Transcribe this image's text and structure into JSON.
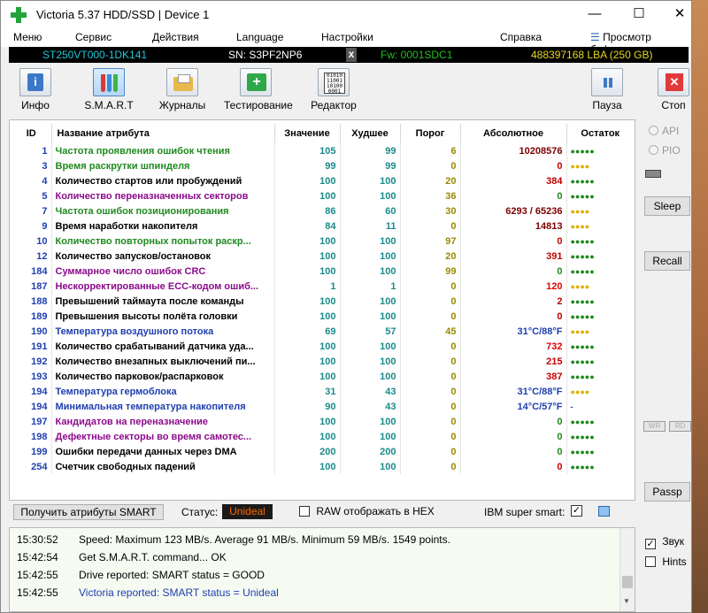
{
  "window": {
    "title": "Victoria 5.37 HDD/SSD | Device 1",
    "controls": {
      "minimize": "—",
      "maximize": "☐",
      "close": "✕"
    }
  },
  "menu": {
    "items": [
      "Меню",
      "Сервис",
      "Действия",
      "Language",
      "Настройки",
      "Справка"
    ],
    "buffer_view": "Просмотр буфера"
  },
  "drive": {
    "model": "ST250VT000-1DK141",
    "serial": "SN: S3PF2NP6",
    "close": "x",
    "firmware": "Fw: 0001SDC1",
    "lba": "488397168 LBA (250 GB)"
  },
  "toolbar": {
    "info": "Инфо",
    "smart": "S.M.A.R.T",
    "logs": "Журналы",
    "testing": "Тестирование",
    "editor": "Редактор",
    "pause": "Пауза",
    "stop": "Стоп"
  },
  "table": {
    "headers": [
      "ID",
      "Название атрибута",
      "Значение",
      "Худшее",
      "Порог",
      "Абсолютное",
      "Остаток"
    ],
    "rows": [
      {
        "id": "1",
        "name": "Частота проявления ошибок чтения",
        "value": "105",
        "worst": "99",
        "threshold": "6",
        "raw": "10208576",
        "rest": "●●●●●",
        "name_color": "#1f8a1f",
        "raw_color": "#7a0000",
        "rest_color": "#1f8a1f"
      },
      {
        "id": "3",
        "name": "Время раскрутки шпинделя",
        "value": "99",
        "worst": "99",
        "threshold": "0",
        "raw": "0",
        "rest": "●●●●",
        "name_color": "#1f8a1f",
        "raw_color": "#c00000",
        "rest_color": "#e0b000"
      },
      {
        "id": "4",
        "name": "Количество стартов или пробуждений",
        "value": "100",
        "worst": "100",
        "threshold": "20",
        "raw": "384",
        "rest": "●●●●●",
        "name_color": "#000000",
        "raw_color": "#c00000",
        "rest_color": "#1f8a1f"
      },
      {
        "id": "5",
        "name": "Количество переназначенных секторов",
        "value": "100",
        "worst": "100",
        "threshold": "36",
        "raw": "0",
        "rest": "●●●●●",
        "name_color": "#8b0a8b",
        "raw_color": "#1f8a1f",
        "rest_color": "#1f8a1f"
      },
      {
        "id": "7",
        "name": "Частота ошибок позиционирования",
        "value": "86",
        "worst": "60",
        "threshold": "30",
        "raw": "6293 / 65236",
        "rest": "●●●●",
        "name_color": "#1f8a1f",
        "raw_color": "#7a0000",
        "rest_color": "#e0b000"
      },
      {
        "id": "9",
        "name": "Время наработки накопителя",
        "value": "84",
        "worst": "11",
        "threshold": "0",
        "raw": "14813",
        "rest": "●●●●",
        "name_color": "#000000",
        "raw_color": "#7a0000",
        "rest_color": "#e0b000"
      },
      {
        "id": "10",
        "name": "Количество повторных попыток раскр...",
        "value": "100",
        "worst": "100",
        "threshold": "97",
        "raw": "0",
        "rest": "●●●●●",
        "name_color": "#1f8a1f",
        "raw_color": "#c00000",
        "rest_color": "#1f8a1f"
      },
      {
        "id": "12",
        "name": "Количество запусков/остановок",
        "value": "100",
        "worst": "100",
        "threshold": "20",
        "raw": "391",
        "rest": "●●●●●",
        "name_color": "#000000",
        "raw_color": "#c00000",
        "rest_color": "#1f8a1f"
      },
      {
        "id": "184",
        "name": "Суммарное число ошибок CRC",
        "value": "100",
        "worst": "100",
        "threshold": "99",
        "raw": "0",
        "rest": "●●●●●",
        "name_color": "#8b0a8b",
        "raw_color": "#1f8a1f",
        "rest_color": "#1f8a1f"
      },
      {
        "id": "187",
        "name": "Нескорректированные ECC-кодом ошиб...",
        "value": "1",
        "worst": "1",
        "threshold": "0",
        "raw": "120",
        "rest": "●●●●",
        "name_color": "#8b0a8b",
        "raw_color": "#e00000",
        "rest_color": "#e0b000"
      },
      {
        "id": "188",
        "name": "Превышений таймаута после команды",
        "value": "100",
        "worst": "100",
        "threshold": "0",
        "raw": "2",
        "rest": "●●●●●",
        "name_color": "#000000",
        "raw_color": "#c00000",
        "rest_color": "#1f8a1f"
      },
      {
        "id": "189",
        "name": "Превышения высоты полёта головки",
        "value": "100",
        "worst": "100",
        "threshold": "0",
        "raw": "0",
        "rest": "●●●●●",
        "name_color": "#000000",
        "raw_color": "#c00000",
        "rest_color": "#1f8a1f"
      },
      {
        "id": "190",
        "name": "Температура воздушного потока",
        "value": "69",
        "worst": "57",
        "threshold": "45",
        "raw": "31°C/88°F",
        "rest": "●●●●",
        "name_color": "#1f3fb0",
        "raw_color": "#1f3fb0",
        "rest_color": "#e0b000"
      },
      {
        "id": "191",
        "name": "Количество срабатываний датчика уда...",
        "value": "100",
        "worst": "100",
        "threshold": "0",
        "raw": "732",
        "rest": "●●●●●",
        "name_color": "#000000",
        "raw_color": "#e00000",
        "rest_color": "#1f8a1f"
      },
      {
        "id": "192",
        "name": "Количество внезапных выключений пи...",
        "value": "100",
        "worst": "100",
        "threshold": "0",
        "raw": "215",
        "rest": "●●●●●",
        "name_color": "#000000",
        "raw_color": "#c00000",
        "rest_color": "#1f8a1f"
      },
      {
        "id": "193",
        "name": "Количество парковок/распарковок",
        "value": "100",
        "worst": "100",
        "threshold": "0",
        "raw": "387",
        "rest": "●●●●●",
        "name_color": "#000000",
        "raw_color": "#c00000",
        "rest_color": "#1f8a1f"
      },
      {
        "id": "194",
        "name": "Температура гермоблока",
        "value": "31",
        "worst": "43",
        "threshold": "0",
        "raw": "31°C/88°F",
        "rest": "●●●●",
        "name_color": "#1f3fb0",
        "raw_color": "#1f3fb0",
        "rest_color": "#e0b000"
      },
      {
        "id": "194",
        "name": "Минимальная температура накопителя",
        "value": "90",
        "worst": "43",
        "threshold": "0",
        "raw": "14°C/57°F",
        "rest": "-",
        "name_color": "#1f3fb0",
        "raw_color": "#1f3fb0",
        "rest_color": "#1f3fb0"
      },
      {
        "id": "197",
        "name": "Кандидатов на переназначение",
        "value": "100",
        "worst": "100",
        "threshold": "0",
        "raw": "0",
        "rest": "●●●●●",
        "name_color": "#8b0a8b",
        "raw_color": "#1f8a1f",
        "rest_color": "#1f8a1f"
      },
      {
        "id": "198",
        "name": "Дефектные секторы во время самотес...",
        "value": "100",
        "worst": "100",
        "threshold": "0",
        "raw": "0",
        "rest": "●●●●●",
        "name_color": "#8b0a8b",
        "raw_color": "#1f8a1f",
        "rest_color": "#1f8a1f"
      },
      {
        "id": "199",
        "name": "Ошибки передачи данных через DMA",
        "value": "200",
        "worst": "200",
        "threshold": "0",
        "raw": "0",
        "rest": "●●●●●",
        "name_color": "#000000",
        "raw_color": "#1f8a1f",
        "rest_color": "#1f8a1f"
      },
      {
        "id": "254",
        "name": "Счетчик свободных падений",
        "value": "100",
        "worst": "100",
        "threshold": "0",
        "raw": "0",
        "rest": "●●●●●",
        "name_color": "#000000",
        "raw_color": "#c00000",
        "rest_color": "#1f8a1f"
      }
    ]
  },
  "side": {
    "api": "API",
    "pio": "PIO",
    "sleep": "Sleep",
    "recall": "Recall",
    "wr": "WR",
    "rd": "RD",
    "passp": "Passp"
  },
  "status": {
    "get_button": "Получить атрибуты SMART",
    "label": "Статус:",
    "value": "Unideal",
    "raw_hex": "RAW отображать в HEX",
    "ibm": "IBM super smart:",
    "ibm_checked": "✓"
  },
  "log": [
    {
      "time": "15:30:52",
      "msg": "Speed: Maximum 123 MB/s. Average 91 MB/s. Minimum 59 MB/s. 1549 points.",
      "color": "#000000"
    },
    {
      "time": "15:42:54",
      "msg": "Get S.M.A.R.T. command... OK",
      "color": "#000000"
    },
    {
      "time": "15:42:55",
      "msg": "Drive reported: SMART status = GOOD",
      "color": "#000000"
    },
    {
      "time": "15:42:55",
      "msg": "Victoria reported: SMART status = Unideal",
      "color": "#1f3fb0"
    }
  ],
  "options": {
    "sound": "Звук",
    "sound_checked": "✓",
    "hints": "Hints"
  },
  "colors": {
    "value_teal": "#1a8a8a",
    "worst_teal": "#1a8a8a",
    "threshold_olive": "#9a8a00",
    "model_cyan": "#20c8d8",
    "firmware_green": "#20c020",
    "lba_yellow": "#e8d820",
    "status_bg": "#1a1a1a",
    "status_fg": "#ff6a00"
  }
}
